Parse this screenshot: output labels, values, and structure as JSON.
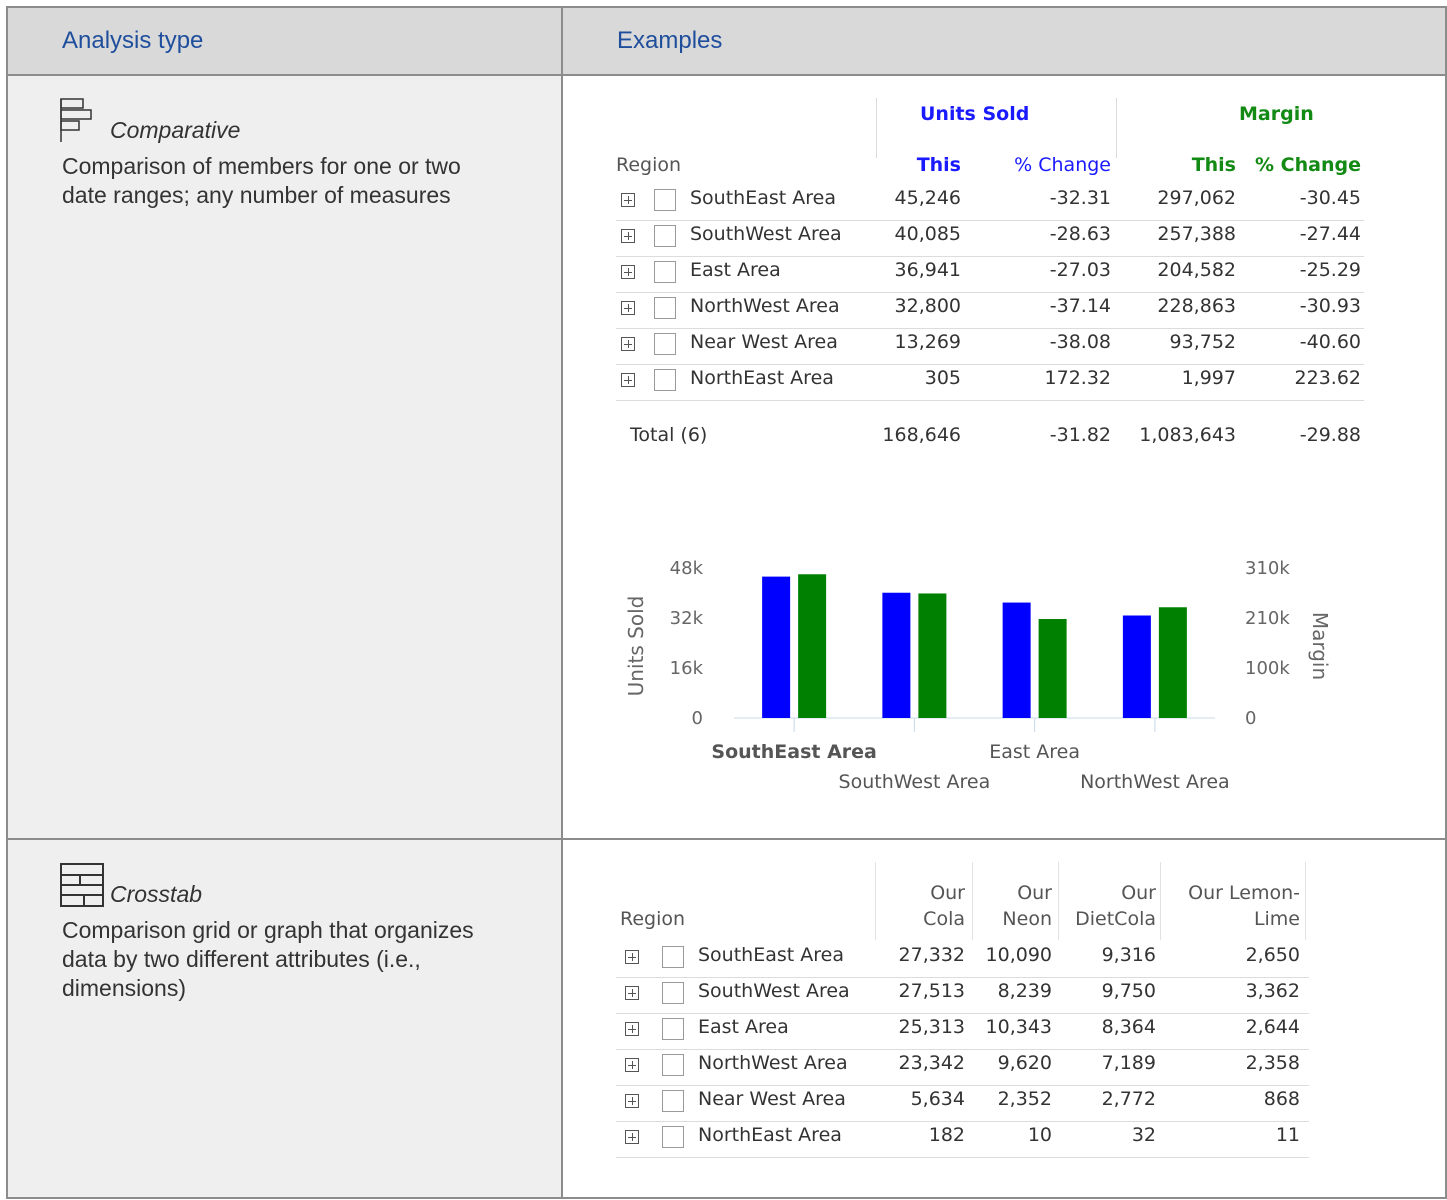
{
  "header": {
    "col1": "Analysis type",
    "col2": "Examples"
  },
  "comparative": {
    "name": "Comparative",
    "icon": "comparative-icon",
    "description": "Comparison of members for one or two date ranges; any number of measures",
    "grid": {
      "group_units": "Units Sold",
      "group_margin": "Margin",
      "col_region": "Region",
      "col_this": "This",
      "col_pct": "% Change",
      "rows": [
        {
          "region": "SouthEast Area",
          "units": "45,246",
          "units_pct": "-32.31",
          "margin": "297,062",
          "margin_pct": "-30.45"
        },
        {
          "region": "SouthWest Area",
          "units": "40,085",
          "units_pct": "-28.63",
          "margin": "257,388",
          "margin_pct": "-27.44"
        },
        {
          "region": "East Area",
          "units": "36,941",
          "units_pct": "-27.03",
          "margin": "204,582",
          "margin_pct": "-25.29"
        },
        {
          "region": "NorthWest Area",
          "units": "32,800",
          "units_pct": "-37.14",
          "margin": "228,863",
          "margin_pct": "-30.93"
        },
        {
          "region": "Near West Area",
          "units": "13,269",
          "units_pct": "-38.08",
          "margin": "93,752",
          "margin_pct": "-40.60"
        },
        {
          "region": "NorthEast Area",
          "units": "305",
          "units_pct": "172.32",
          "margin": "1,997",
          "margin_pct": "223.62"
        }
      ],
      "total": {
        "label": "Total (6)",
        "units": "168,646",
        "units_pct": "-31.82",
        "margin": "1,083,643",
        "margin_pct": "-29.88"
      }
    },
    "colors": {
      "units": "#0000ff",
      "margin": "#008000"
    }
  },
  "chart_data": {
    "type": "bar",
    "categories": [
      "SouthEast Area",
      "SouthWest Area",
      "East Area",
      "NorthWest Area"
    ],
    "series": [
      {
        "name": "Units Sold (This)",
        "axis": "left",
        "values": [
          45246,
          40085,
          36941,
          32800
        ]
      },
      {
        "name": "Margin (This)",
        "axis": "right",
        "values": [
          297062,
          257388,
          204582,
          228863
        ]
      }
    ],
    "ylabel": "Units Sold",
    "y2label": "Margin",
    "ylim": [
      0,
      48000
    ],
    "y2lim": [
      0,
      310000
    ],
    "yticks": [
      "0",
      "16k",
      "32k",
      "48k"
    ],
    "y2ticks": [
      "0",
      "100k",
      "210k",
      "310k"
    ],
    "legend": "bottom-center",
    "highlighted_category": "SouthEast Area"
  },
  "crosstab": {
    "name": "Crosstab",
    "icon": "crosstab-icon",
    "description": "Comparison grid or graph that organizes data by two different attributes (i.e., dimensions)",
    "grid": {
      "col_region": "Region",
      "columns": [
        {
          "line1": "Our",
          "line2": "Cola"
        },
        {
          "line1": "Our",
          "line2": "Neon"
        },
        {
          "line1": "Our",
          "line2": "DietCola"
        },
        {
          "line1": "Our Lemon-",
          "line2": "Lime"
        }
      ],
      "rows": [
        {
          "region": "SouthEast Area",
          "values": [
            "27,332",
            "10,090",
            "9,316",
            "2,650"
          ]
        },
        {
          "region": "SouthWest Area",
          "values": [
            "27,513",
            "8,239",
            "9,750",
            "3,362"
          ]
        },
        {
          "region": "East Area",
          "values": [
            "25,313",
            "10,343",
            "8,364",
            "2,644"
          ]
        },
        {
          "region": "NorthWest Area",
          "values": [
            "23,342",
            "9,620",
            "7,189",
            "2,358"
          ]
        },
        {
          "region": "Near West Area",
          "values": [
            "5,634",
            "2,352",
            "2,772",
            "868"
          ]
        },
        {
          "region": "NorthEast Area",
          "values": [
            "182",
            "10",
            "32",
            "11"
          ]
        }
      ]
    }
  }
}
